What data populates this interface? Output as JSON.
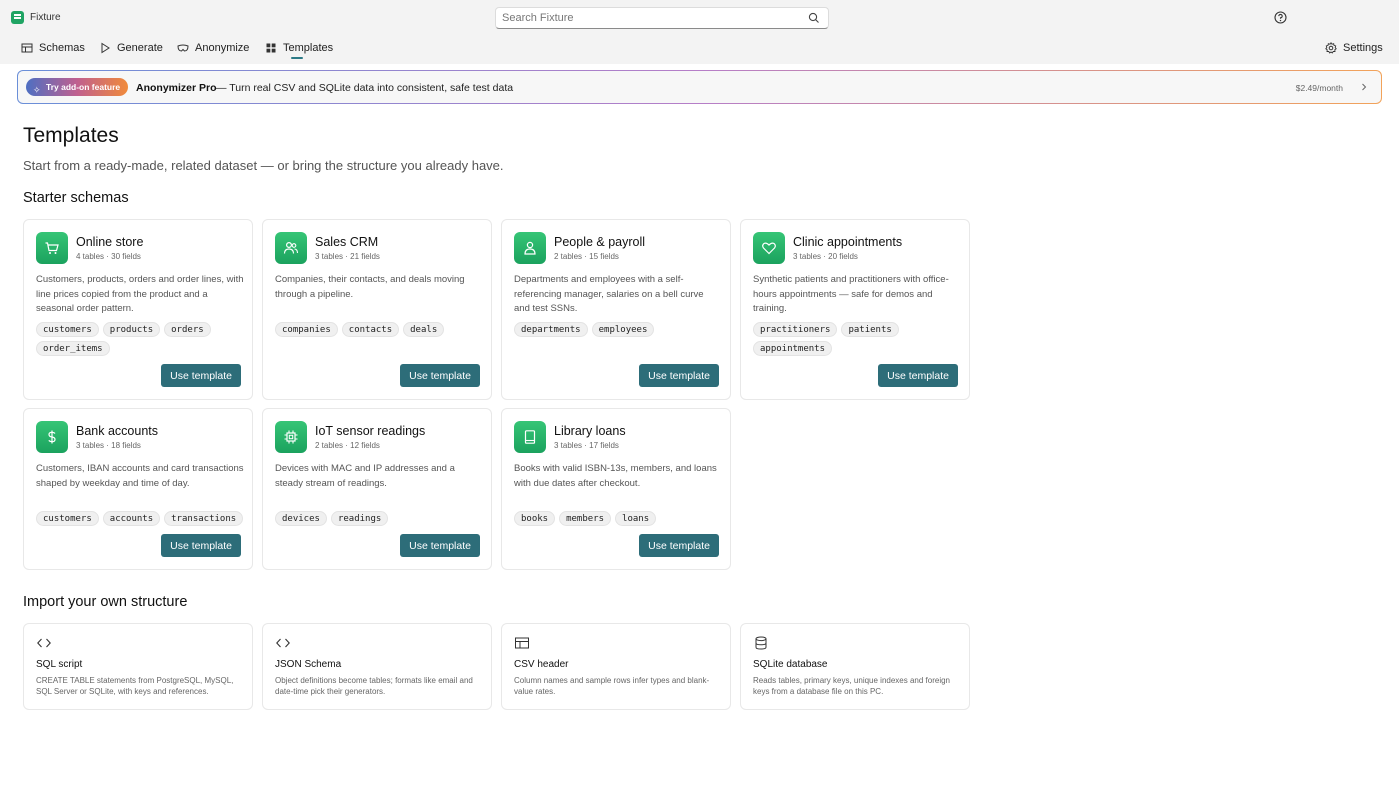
{
  "app": {
    "title": "Fixture"
  },
  "search": {
    "placeholder": "Search Fixture"
  },
  "nav": {
    "tabs": [
      {
        "label": "Schemas",
        "icon": "table-icon"
      },
      {
        "label": "Generate",
        "icon": "play-icon"
      },
      {
        "label": "Anonymize",
        "icon": "mask-icon"
      },
      {
        "label": "Templates",
        "icon": "grid-icon",
        "active": true
      }
    ],
    "settings_label": "Settings"
  },
  "promo": {
    "pill_label": "Try add-on feature",
    "title": "Anonymizer Pro",
    "description": "— Turn real CSV and SQLite data into consistent, safe test data",
    "price": "$2.49/month"
  },
  "page": {
    "title": "Templates",
    "subtitle": "Start from a ready-made, related dataset — or bring the structure you already have."
  },
  "starter": {
    "section_title": "Starter schemas",
    "use_label": "Use template",
    "cards": [
      {
        "name": "Online store",
        "meta": "4 tables · 30 fields",
        "icon": "cart-icon",
        "desc": "Customers, products, orders and order lines, with line prices copied from the product and a seasonal order pattern.",
        "tags": [
          "customers",
          "products",
          "orders",
          "order_items"
        ]
      },
      {
        "name": "Sales CRM",
        "meta": "3 tables · 21 fields",
        "icon": "people-icon",
        "desc": "Companies, their contacts, and deals moving through a pipeline.",
        "tags": [
          "companies",
          "contacts",
          "deals"
        ]
      },
      {
        "name": "People & payroll",
        "meta": "2 tables · 15 fields",
        "icon": "person-icon",
        "desc": "Departments and employees with a self-referencing manager, salaries on a bell curve and test SSNs.",
        "tags": [
          "departments",
          "employees"
        ]
      },
      {
        "name": "Clinic appointments",
        "meta": "3 tables · 20 fields",
        "icon": "heart-icon",
        "desc": "Synthetic patients and practitioners with office-hours appointments — safe for demos and training.",
        "tags": [
          "practitioners",
          "patients",
          "appointments"
        ]
      },
      {
        "name": "Bank accounts",
        "meta": "3 tables · 18 fields",
        "icon": "dollar-icon",
        "desc": "Customers, IBAN accounts and card transactions shaped by weekday and time of day.",
        "tags": [
          "customers",
          "accounts",
          "transactions"
        ]
      },
      {
        "name": "IoT sensor readings",
        "meta": "2 tables · 12 fields",
        "icon": "chip-icon",
        "desc": "Devices with MAC and IP addresses and a steady stream of readings.",
        "tags": [
          "devices",
          "readings"
        ]
      },
      {
        "name": "Library loans",
        "meta": "3 tables · 17 fields",
        "icon": "book-icon",
        "desc": "Books with valid ISBN-13s, members, and loans with due dates after checkout.",
        "tags": [
          "books",
          "members",
          "loans"
        ]
      }
    ]
  },
  "import": {
    "section_title": "Import your own structure",
    "cards": [
      {
        "name": "SQL script",
        "icon": "code-icon",
        "desc": "CREATE TABLE statements from PostgreSQL, MySQL, SQL Server or SQLite, with keys and references."
      },
      {
        "name": "JSON Schema",
        "icon": "code-icon",
        "desc": "Object definitions become tables; formats like email and date-time pick their generators."
      },
      {
        "name": "CSV header",
        "icon": "table-icon",
        "desc": "Column names and sample rows infer types and blank-value rates."
      },
      {
        "name": "SQLite database",
        "icon": "database-icon",
        "desc": "Reads tables, primary keys, unique indexes and foreign keys from a database file on this PC."
      }
    ]
  }
}
